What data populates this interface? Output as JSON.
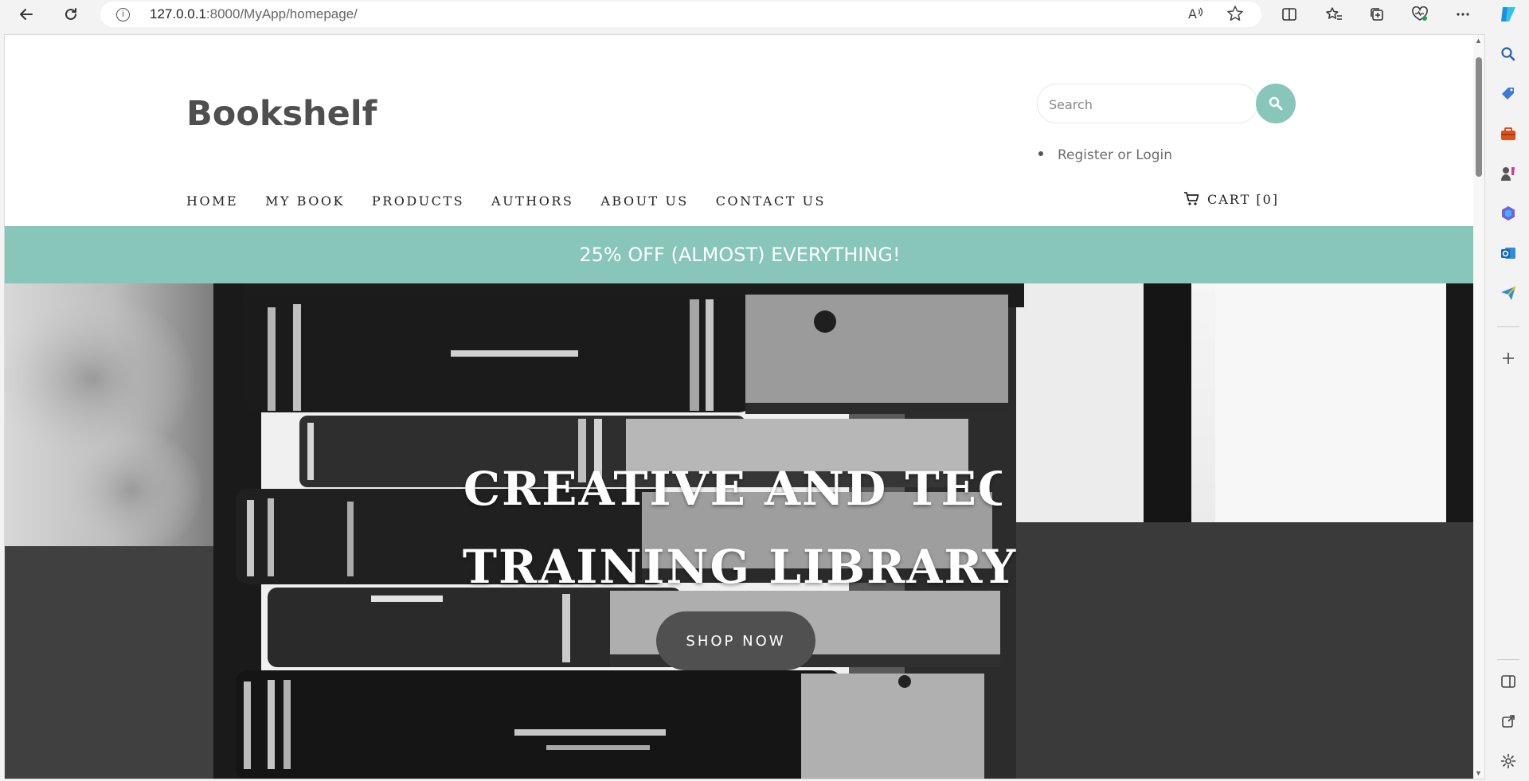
{
  "browser": {
    "url_host": "127.0.0.1",
    "url_rest": ":8000/MyApp/homepage/"
  },
  "site": {
    "title": "Bookshelf",
    "search_placeholder": "Search",
    "account_link": "Register or Login",
    "nav": [
      "HOME",
      "MY BOOK",
      "PRODUCTS",
      "AUTHORS",
      "ABOUT US",
      "CONTACT US"
    ],
    "cart_label": "CART [0]",
    "promo": "25% OFF (ALMOST) EVERYTHING!",
    "hero_line1": "CREATIVE AND TEC",
    "hero_line2": "TRAINING LIBRARY",
    "hero_button": "SHOP NOW"
  },
  "colors": {
    "accent": "#87c6b9",
    "button_dark": "#505050",
    "title_text": "#4f4f4f"
  }
}
